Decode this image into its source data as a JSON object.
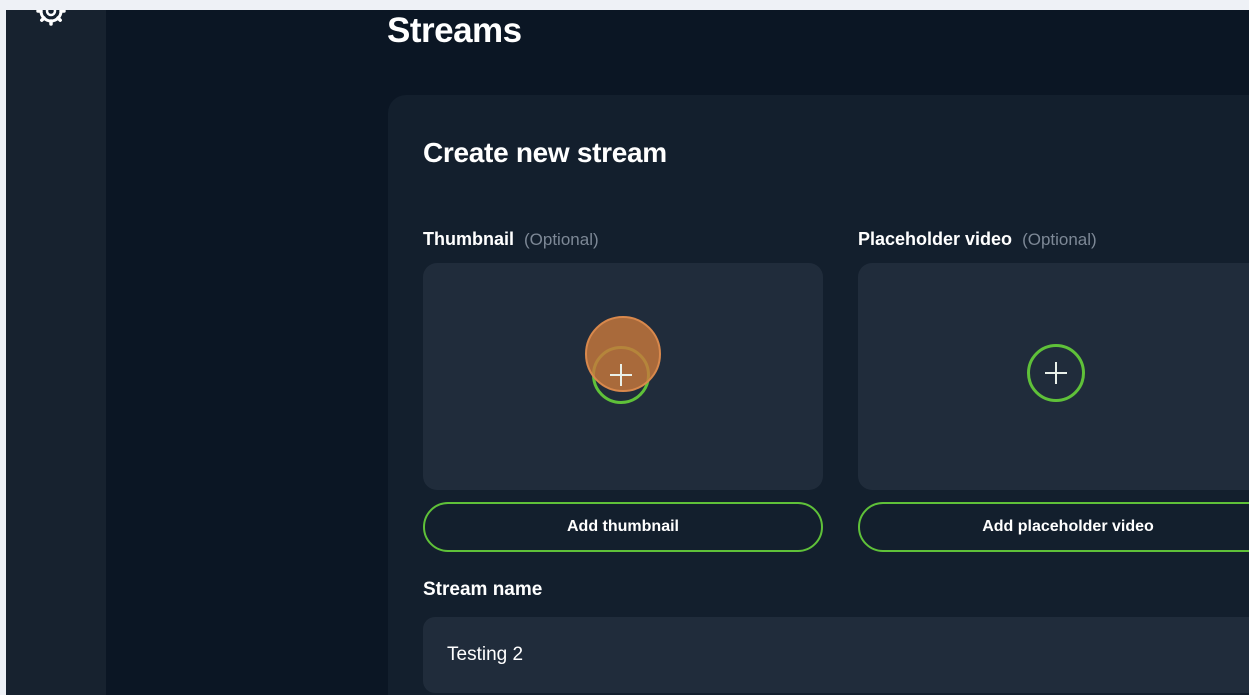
{
  "page": {
    "title": "Streams"
  },
  "sidebar": {
    "icons": [
      "gear-icon"
    ]
  },
  "form": {
    "title": "Create new stream",
    "thumbnail": {
      "label": "Thumbnail",
      "optional": "(Optional)",
      "upload_icon": "plus-circle-icon",
      "button": "Add thumbnail"
    },
    "placeholder_video": {
      "label": "Placeholder video",
      "optional": "(Optional)",
      "upload_icon": "plus-circle-icon",
      "button": "Add placeholder video"
    },
    "stream_name": {
      "label": "Stream name",
      "value": "Testing 2"
    }
  },
  "colors": {
    "background": "#0b1624",
    "sidebar": "#17222f",
    "card": "#131f2d",
    "tile": "#202c3b",
    "accent": "#5fc139",
    "muted_text": "#7d8896"
  }
}
